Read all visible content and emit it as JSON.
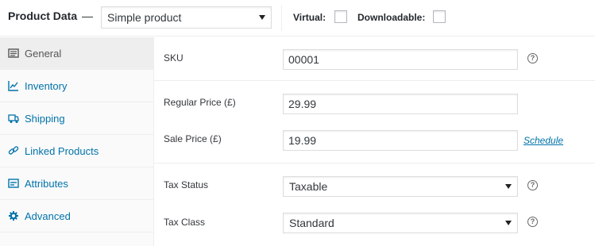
{
  "header": {
    "title": "Product Data",
    "dash": "—",
    "product_type": "Simple product",
    "virtual_label": "Virtual:",
    "downloadable_label": "Downloadable:"
  },
  "sidebar": {
    "items": [
      {
        "label": "General",
        "icon": "general-icon",
        "active": true
      },
      {
        "label": "Inventory",
        "icon": "inventory-icon"
      },
      {
        "label": "Shipping",
        "icon": "truck-icon"
      },
      {
        "label": "Linked Products",
        "icon": "link-icon"
      },
      {
        "label": "Attributes",
        "icon": "attributes-icon"
      },
      {
        "label": "Advanced",
        "icon": "gear-icon"
      }
    ]
  },
  "general": {
    "sku_label": "SKU",
    "sku_value": "00001",
    "regular_price_label": "Regular Price (£)",
    "regular_price_value": "29.99",
    "sale_price_label": "Sale Price (£)",
    "sale_price_value": "19.99",
    "schedule_link": "Schedule",
    "tax_status_label": "Tax Status",
    "tax_status_value": "Taxable",
    "tax_class_label": "Tax Class",
    "tax_class_value": "Standard",
    "help_glyph": "?"
  },
  "colors": {
    "link": "#0073aa",
    "border": "#eeeeee",
    "sidebar_bg": "#fafafa",
    "active_tab_bg": "#eeeeee"
  }
}
